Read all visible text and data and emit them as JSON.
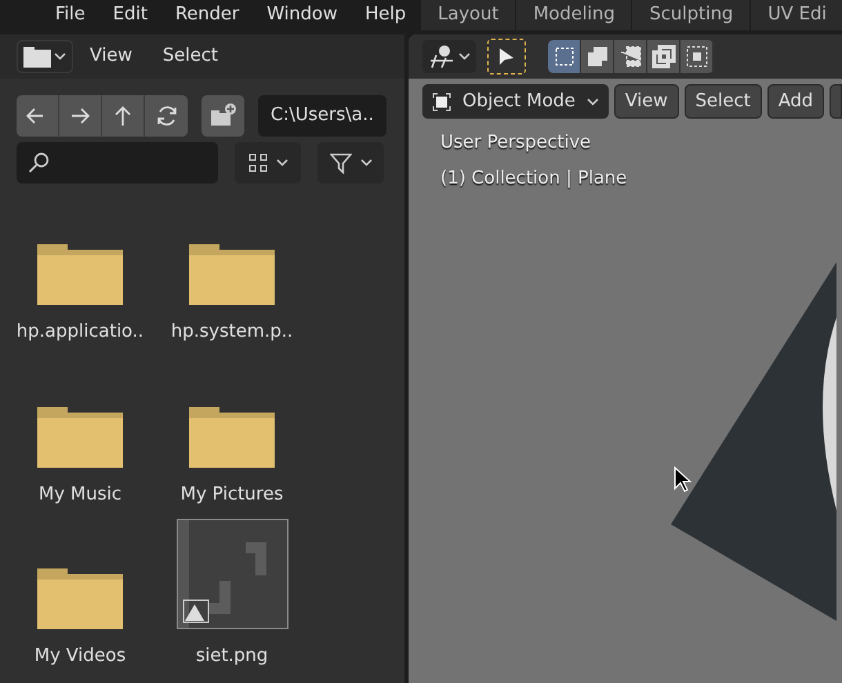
{
  "menu_bar": {
    "items": [
      "File",
      "Edit",
      "Render",
      "Window",
      "Help"
    ],
    "workspaces": [
      "Layout",
      "Modeling",
      "Sculpting",
      "UV Edi"
    ]
  },
  "file_browser": {
    "header_menus": [
      "View",
      "Select"
    ],
    "path": "C:\\Users\\a..",
    "files": [
      {
        "name": "hp.applicatio..",
        "kind": "folder"
      },
      {
        "name": "hp.system.p..",
        "kind": "folder"
      },
      {
        "name": "My Music",
        "kind": "folder"
      },
      {
        "name": "My Pictures",
        "kind": "folder"
      },
      {
        "name": "My Videos",
        "kind": "folder"
      },
      {
        "name": "siet.png",
        "kind": "image"
      }
    ]
  },
  "viewport": {
    "select_modes": [
      {
        "selected": true
      },
      {
        "selected": false
      },
      {
        "selected": false
      },
      {
        "selected": false
      },
      {
        "selected": false
      }
    ],
    "mode": "Object Mode",
    "menus": [
      "View",
      "Select",
      "Add"
    ],
    "overlay": [
      "User Perspective",
      "(1) Collection | Plane"
    ]
  }
}
